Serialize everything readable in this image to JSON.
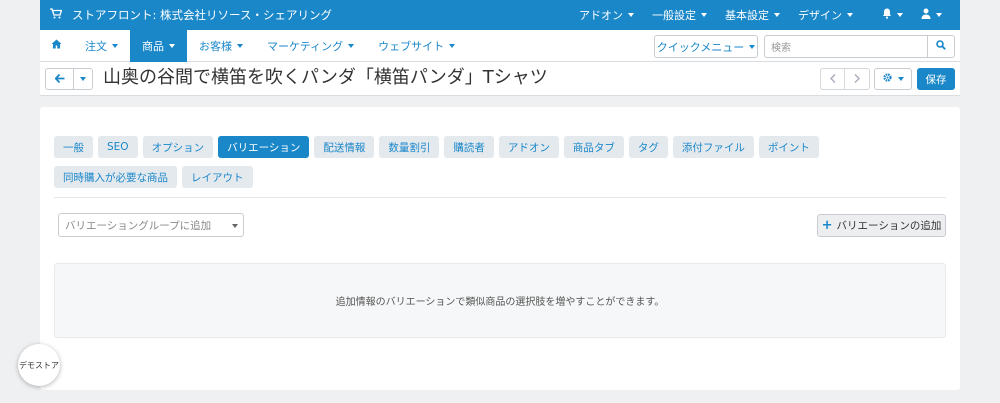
{
  "topbar": {
    "store_icon": "cart-icon",
    "store_label": "ストアフロント: 株式会社リソース・シェアリング",
    "items": [
      {
        "label": "アドオン"
      },
      {
        "label": "一般設定"
      },
      {
        "label": "基本設定"
      },
      {
        "label": "デザイン"
      }
    ],
    "bell_icon": "bell-icon",
    "user_icon": "user-icon",
    "color": "#1a87c9"
  },
  "menu": {
    "home_icon": "home-icon",
    "items": [
      {
        "label": "注文"
      },
      {
        "label": "商品",
        "active": true
      },
      {
        "label": "お客様"
      },
      {
        "label": "マーケティング"
      },
      {
        "label": "ウェブサイト"
      }
    ],
    "quick_menu": "クイックメニュー",
    "search_placeholder": "検索"
  },
  "header": {
    "title": "山奥の谷間で横笛を吹くパンダ「横笛パンダ」Tシャツ",
    "save_label": "保存"
  },
  "tabs": [
    "一般",
    "SEO",
    "オプション",
    "バリエーション",
    "配送情報",
    "数量割引",
    "購読者",
    "アドオン",
    "商品タブ",
    "タグ",
    "添付ファイル",
    "ポイント",
    "同時購入が必要な商品",
    "レイアウト"
  ],
  "active_tab": "バリエーション",
  "variations": {
    "group_placeholder": "バリエーショングループに追加",
    "add_button": "バリエーションの追加",
    "empty_message": "追加情報のバリエーションで類似商品の選択肢を増やすことができます。"
  },
  "demo_badge": "デモストア"
}
